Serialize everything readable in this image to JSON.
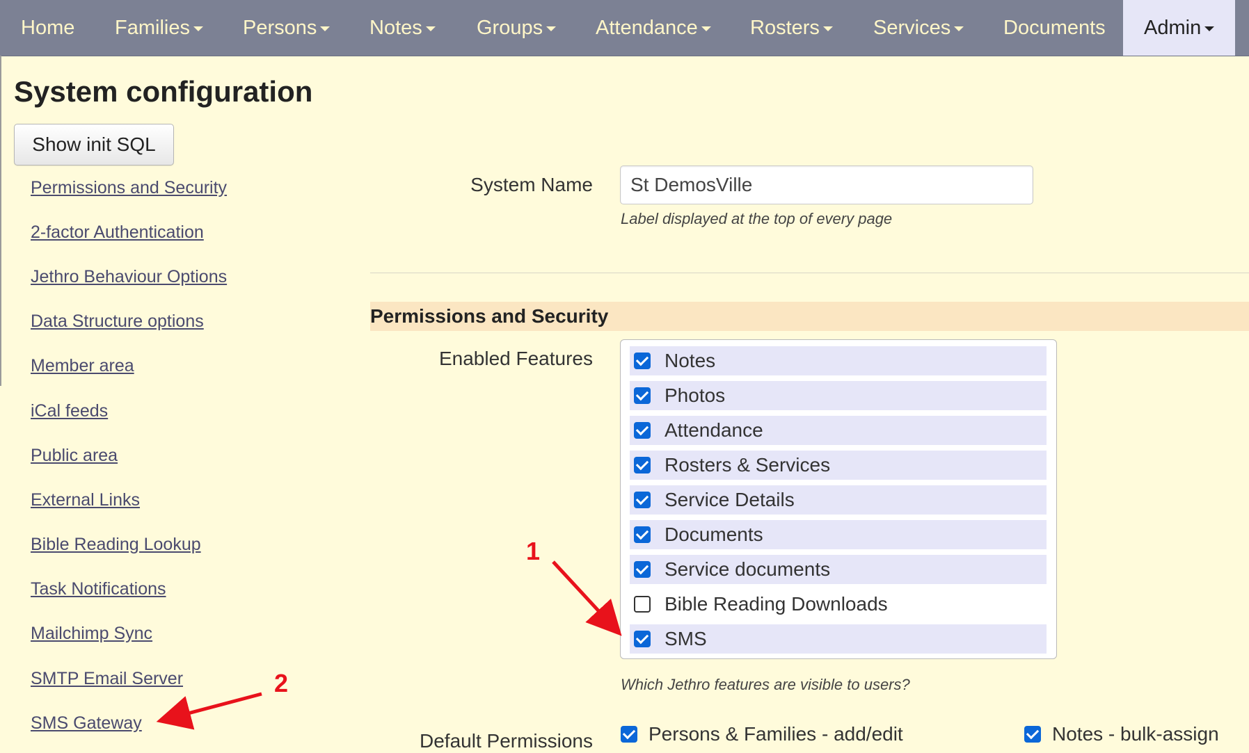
{
  "nav": {
    "items": [
      {
        "label": "Home",
        "dropdown": false
      },
      {
        "label": "Families",
        "dropdown": true
      },
      {
        "label": "Persons",
        "dropdown": true
      },
      {
        "label": "Notes",
        "dropdown": true
      },
      {
        "label": "Groups",
        "dropdown": true
      },
      {
        "label": "Attendance",
        "dropdown": true
      },
      {
        "label": "Rosters",
        "dropdown": true
      },
      {
        "label": "Services",
        "dropdown": true
      },
      {
        "label": "Documents",
        "dropdown": false
      },
      {
        "label": "Admin",
        "dropdown": true,
        "active": true
      }
    ]
  },
  "page": {
    "title": "System configuration",
    "init_sql_button": "Show init SQL"
  },
  "sidebar": {
    "links": [
      "Permissions and Security",
      "2-factor Authentication",
      "Jethro Behaviour Options",
      "Data Structure options",
      "Member area",
      "iCal feeds",
      "Public area",
      "External Links",
      "Bible Reading Lookup",
      "Task Notifications",
      "Mailchimp Sync",
      "SMTP Email Server",
      "SMS Gateway"
    ]
  },
  "system_name": {
    "label": "System Name",
    "value": "St DemosVille",
    "help": "Label displayed at the top of every page"
  },
  "permissions_section": {
    "heading": "Permissions and Security",
    "enabled_features": {
      "label": "Enabled Features",
      "help": "Which Jethro features are visible to users?",
      "items": [
        {
          "label": "Notes",
          "checked": true
        },
        {
          "label": "Photos",
          "checked": true
        },
        {
          "label": "Attendance",
          "checked": true
        },
        {
          "label": "Rosters & Services",
          "checked": true
        },
        {
          "label": "Service Details",
          "checked": true
        },
        {
          "label": "Documents",
          "checked": true
        },
        {
          "label": "Service documents",
          "checked": true
        },
        {
          "label": "Bible Reading Downloads",
          "checked": false
        },
        {
          "label": "SMS",
          "checked": true
        }
      ]
    },
    "default_permissions": {
      "label": "Default Permissions",
      "items": [
        {
          "label": "Persons & Families - add/edit",
          "checked": true
        },
        {
          "label": "Notes - bulk-assign",
          "checked": true
        }
      ]
    }
  },
  "annotations": {
    "marker_1": "1",
    "marker_2": "2",
    "color": "#e8121b"
  },
  "colors": {
    "nav_bg": "#7c8194",
    "nav_text": "#fff6c8",
    "page_bg": "#fffbdb",
    "section_head_bg": "#fbe6c2",
    "checked_row_bg": "#e6e6f8",
    "checkbox_blue": "#0b67d8"
  }
}
